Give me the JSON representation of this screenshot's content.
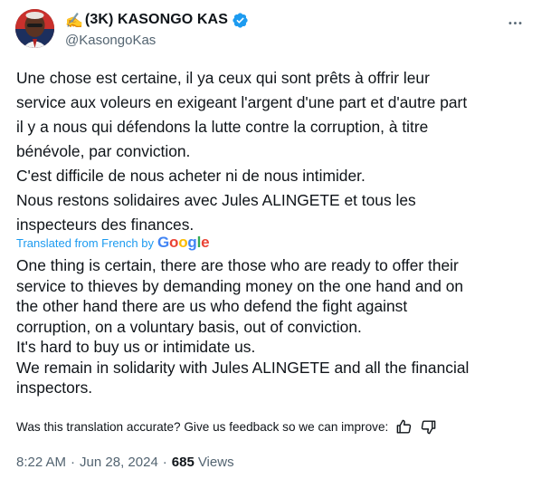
{
  "author": {
    "emoji": "✍️",
    "display_name": "(3K) KASONGO KAS",
    "handle": "@KasongoKas",
    "verified": true,
    "verified_color": "#1d9bf0"
  },
  "header": {
    "more_icon": "more-horizontal-icon"
  },
  "tweet": {
    "original_lines": [
      "Une chose est certaine, il ya ceux qui sont prêts à offrir leur",
      "service aux voleurs en exigeant l'argent d'une part et d'autre part",
      "il y a nous qui défendons la lutte contre la corruption, à titre",
      "bénévole, par conviction.",
      "C'est difficile de nous acheter ni de nous intimider.",
      "Nous restons solidaires avec Jules ALINGETE et tous les",
      "inspecteurs des finances."
    ],
    "translation_label": "Translated from French by",
    "translation_provider": "Google",
    "translated_lines": [
      "One thing is certain, there are those who are ready to offer their",
      "service to thieves by demanding money on the one hand and on",
      "the other hand there are us who defend the fight against",
      "corruption, on a voluntary basis, out of conviction.",
      "It's hard to buy us or intimidate us.",
      "We remain in solidarity with Jules ALINGETE and all the financial",
      "inspectors."
    ]
  },
  "feedback": {
    "prompt": "Was this translation accurate? Give us feedback so we can improve:",
    "icons": [
      "thumbs-up-icon",
      "thumbs-down-icon"
    ]
  },
  "meta": {
    "time": "8:22 AM",
    "separator": "·",
    "date": "Jun 28, 2024",
    "views_count": "685",
    "views_label": "Views"
  },
  "colors": {
    "link": "#1d9bf0",
    "text": "#0f1419",
    "secondary": "#536471"
  }
}
